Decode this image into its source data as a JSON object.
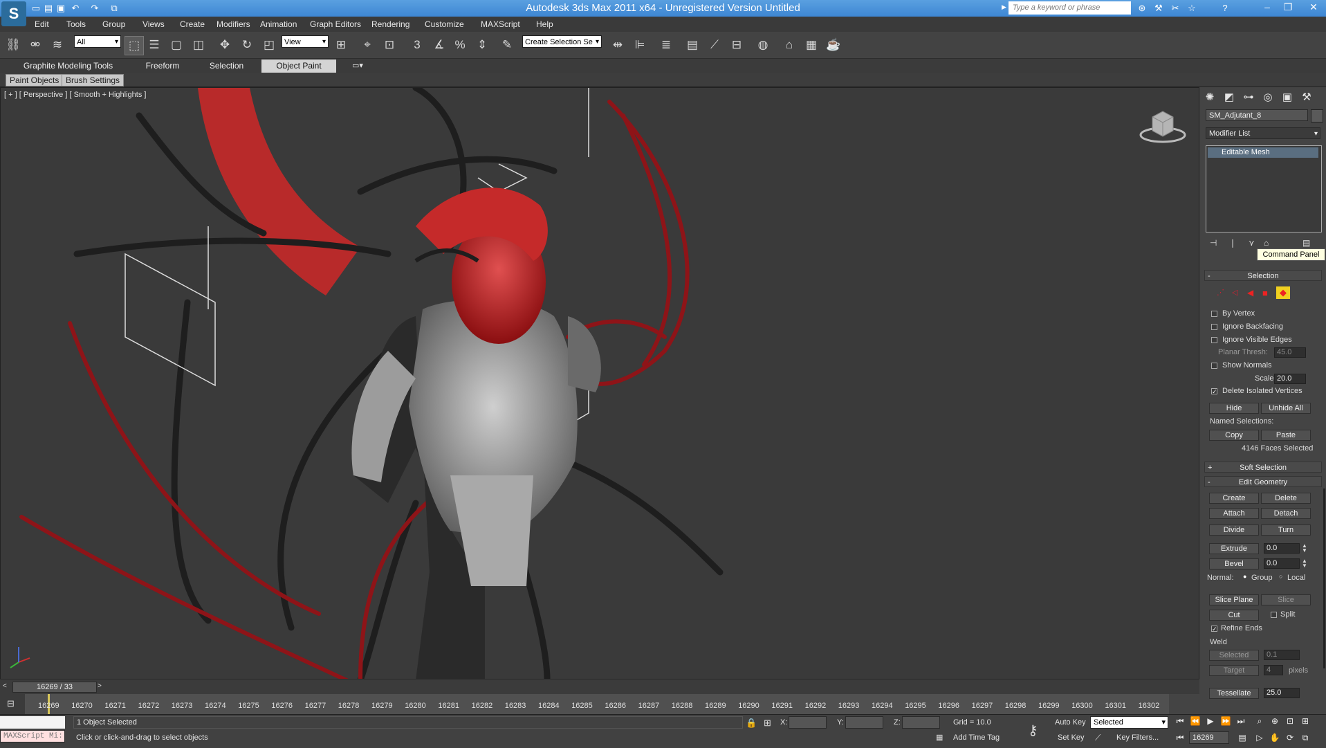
{
  "window": {
    "title": "Autodesk 3ds Max  2011 x64  - Unregistered Version   Untitled",
    "search_placeholder": "Type a keyword or phrase"
  },
  "menu": [
    "Edit",
    "Tools",
    "Group",
    "Views",
    "Create",
    "Modifiers",
    "Animation",
    "Graph Editors",
    "Rendering",
    "Customize",
    "MAXScript",
    "Help"
  ],
  "toolbar": {
    "selection_filter": "All",
    "ref_coord": "View",
    "named_selection": "Create Selection Se"
  },
  "ribbon": {
    "tabs": [
      "Graphite Modeling Tools",
      "Freeform",
      "Selection",
      "Object Paint"
    ],
    "active_tab": "Object Paint",
    "subtabs": [
      "Paint Objects",
      "Brush Settings"
    ]
  },
  "viewport": {
    "label": "[ + ] [ Perspective ] [ Smooth + Highlights ]"
  },
  "command_panel": {
    "object_name": "SM_Adjutant_8",
    "modifier_list": "Modifier List",
    "stack_item": "Editable Mesh",
    "tooltip": "Command Panel",
    "selection": {
      "title": "Selection",
      "by_vertex": "By Vertex",
      "ignore_backfacing": "Ignore Backfacing",
      "ignore_visible_edges": "Ignore Visible Edges",
      "planar_thresh_label": "Planar Thresh:",
      "planar_thresh": "45.0",
      "show_normals": "Show Normals",
      "scale_label": "Scale:",
      "scale": "20.0",
      "delete_isolated": "Delete Isolated Vertices",
      "hide": "Hide",
      "unhide_all": "Unhide All",
      "named_selections": "Named Selections:",
      "copy": "Copy",
      "paste": "Paste",
      "status": "4146 Faces Selected"
    },
    "soft_selection": "Soft Selection",
    "edit_geometry": {
      "title": "Edit Geometry",
      "create": "Create",
      "delete": "Delete",
      "attach": "Attach",
      "detach": "Detach",
      "divide": "Divide",
      "turn": "Turn",
      "extrude": "Extrude",
      "extrude_val": "0.0",
      "bevel": "Bevel",
      "bevel_val": "0.0",
      "normal_label": "Normal:",
      "group": "Group",
      "local": "Local",
      "slice_plane": "Slice Plane",
      "slice": "Slice",
      "cut": "Cut",
      "split": "Split",
      "refine_ends": "Refine Ends",
      "weld": "Weld",
      "selected": "Selected",
      "selected_val": "0.1",
      "target": "Target",
      "target_val": "4",
      "pixels": "pixels",
      "tessellate": "Tessellate",
      "tessellate_val": "25.0"
    }
  },
  "timeline": {
    "frame_display": "16269 / 33",
    "ticks": [
      "16269",
      "16270",
      "16271",
      "16272",
      "16273",
      "16274",
      "16275",
      "16276",
      "16277",
      "16278",
      "16279",
      "16280",
      "16281",
      "16282",
      "16283",
      "16284",
      "16285",
      "16286",
      "16287",
      "16288",
      "16289",
      "16290",
      "16291",
      "16292",
      "16293",
      "16294",
      "16295",
      "16296",
      "16297",
      "16298",
      "16299",
      "16300",
      "16301",
      "16302"
    ]
  },
  "status": {
    "maxscript": "MAXScript Mi:",
    "selected": "1 Object Selected",
    "prompt": "Click or click-and-drag to select objects",
    "x_label": "X:",
    "y_label": "Y:",
    "z_label": "Z:",
    "grid": "Grid = 10.0",
    "add_time_tag": "Add Time Tag",
    "auto_key": "Auto Key",
    "set_key": "Set Key",
    "key_mode": "Selected",
    "key_filters": "Key Filters...",
    "current_frame": "16269"
  }
}
